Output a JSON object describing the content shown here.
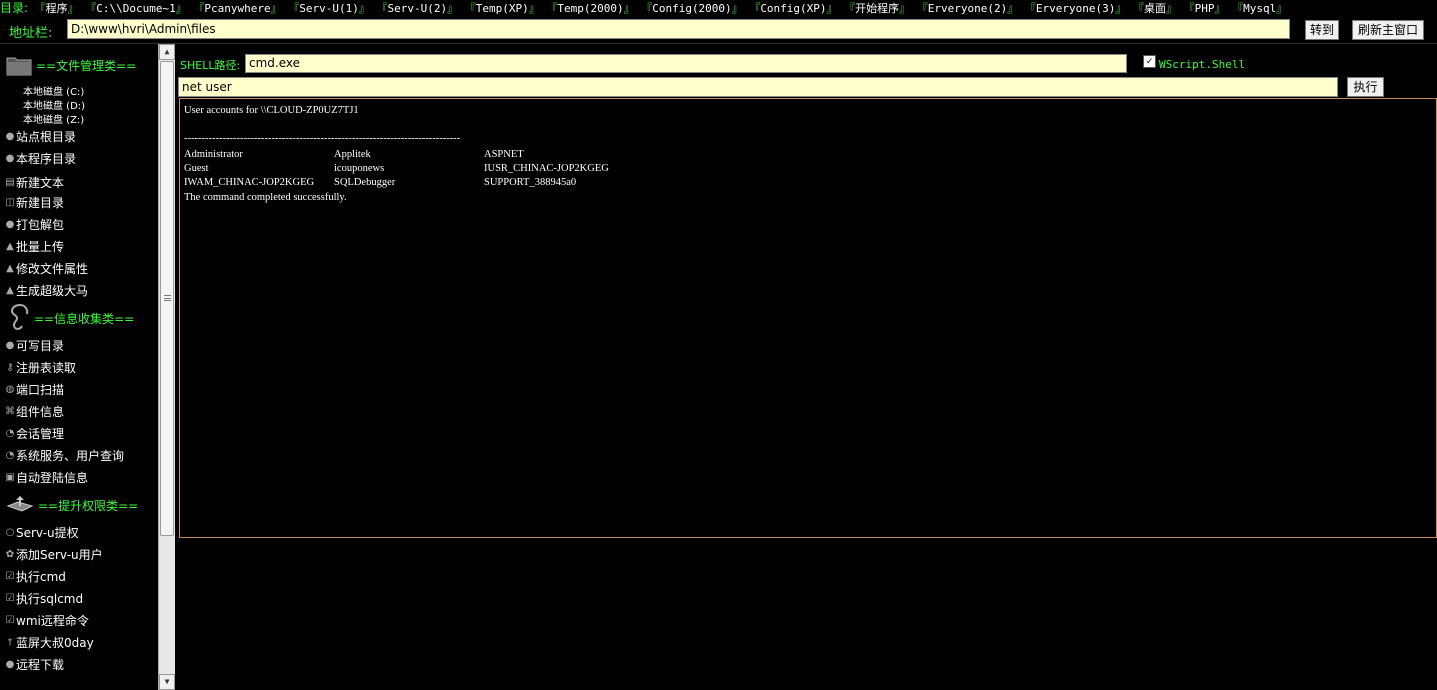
{
  "topbar": {
    "label": "目录:",
    "bookmarks": [
      "程序",
      "C:\\\\Docume~1",
      "Pcanywhere",
      "Serv-U(1)",
      "Serv-U(2)",
      "Temp(XP)",
      "Temp(2000)",
      "Config(2000)",
      "Config(XP)",
      "开始程序",
      "Erveryone(2)",
      "Erveryone(3)",
      "桌面",
      "PHP",
      "Mysql"
    ]
  },
  "address": {
    "label": "地址栏:",
    "value": "D:\\www\\hvri\\Admin\\files",
    "go_label": "转到",
    "refresh_label": "刷新主窗口"
  },
  "sidebar": {
    "file_section": "==文件管理类==",
    "drives": [
      "本地磁盘 (C:)",
      "本地磁盘 (D:)",
      "本地磁盘 (Z:)"
    ],
    "file_items": [
      "站点根目录",
      "本程序目录",
      "新建文本",
      "新建目录",
      "打包解包",
      "批量上传",
      "修改文件属性",
      "生成超级大马"
    ],
    "info_section": "==信息收集类==",
    "info_items": [
      "可写目录",
      "注册表读取",
      "端口扫描",
      "组件信息",
      "会话管理",
      "系统服务、用户查询",
      "自动登陆信息"
    ],
    "priv_section": "==提升权限类==",
    "priv_items": [
      "Serv-u提权",
      "添加Serv-u用户",
      "执行cmd",
      "执行sqlcmd",
      "wmi远程命令",
      "蓝屏大叔0day",
      "远程下载"
    ]
  },
  "shell": {
    "path_label": "SHELL路径:",
    "path_value": "cmd.exe",
    "wscript_checked": true,
    "wscript_label": "WScript.Shell",
    "command_value": "net user",
    "exec_label": "执行"
  },
  "output": {
    "header": "User accounts for \\\\CLOUD-ZP0UZ7TJ1",
    "separator": "-------------------------------------------------------------------------------",
    "accounts": [
      [
        "Administrator",
        "Applitek",
        "ASPNET"
      ],
      [
        "Guest",
        "icouponews",
        "IUSR_CHINAC-JOP2KGEG"
      ],
      [
        "IWAM_CHINAC-JOP2KGEG",
        "SQLDebugger",
        "SUPPORT_388945a0"
      ]
    ],
    "footer": "The command completed successfully."
  }
}
